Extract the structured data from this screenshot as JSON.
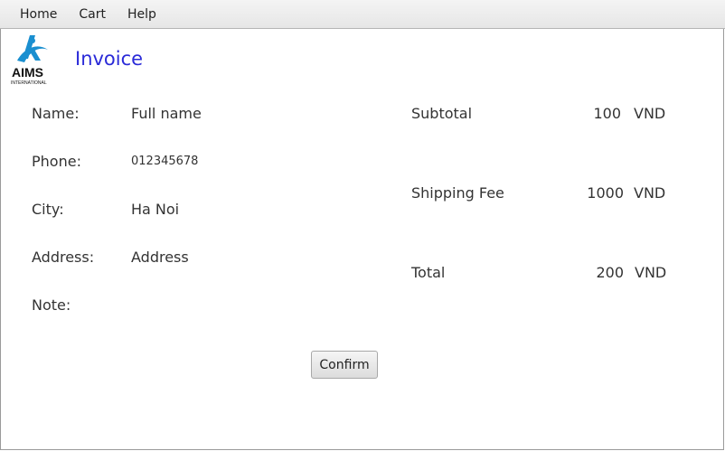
{
  "menu": [
    "Home",
    "Cart",
    "Help"
  ],
  "logo": {
    "text": "AIMS",
    "subtext": "INTERNATIONAL"
  },
  "title": "Invoice",
  "customer": {
    "name_label": "Name:",
    "name_value": "Full name",
    "phone_label": "Phone:",
    "phone_value": "012345678",
    "city_label": "City:",
    "city_value": "Ha Noi",
    "address_label": "Address:",
    "address_value": "Address",
    "note_label": "Note:"
  },
  "summary": {
    "subtotal_label": "Subtotal",
    "subtotal_value": "100",
    "subtotal_currency": "VND",
    "shipping_label": "Shipping Fee",
    "shipping_value": "1000",
    "shipping_currency": "VND",
    "total_label": "Total",
    "total_value": "200",
    "total_currency": "VND"
  },
  "confirm_label": "Confirm",
  "colors": {
    "title": "#2a2ad8",
    "logo_blue": "#1a8fd0"
  }
}
